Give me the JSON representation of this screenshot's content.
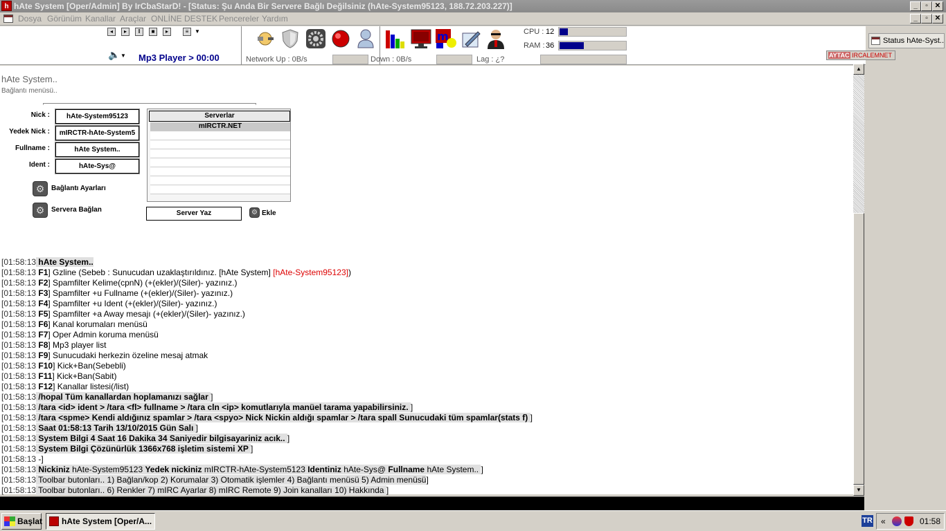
{
  "window": {
    "title": "hAte System [Oper/Admin] By IrCbaStarD! - [Status: Şu Anda Bir Servere Bağlı Değilsiniz (hAte-System95123, 188.72.203.227)]",
    "min": "_",
    "max": "▫",
    "close": "✕"
  },
  "menubar": {
    "items": [
      "Dosya",
      "Görünüm",
      "Kanallar",
      "Araçlar",
      "ONLİNE DESTEK",
      "Pencereler",
      "Yardım"
    ]
  },
  "toolbar": {
    "mp3": "Mp3 Player > 00:00",
    "cpu_label": "CPU :",
    "cpu_value": "12",
    "cpu_fill": 12,
    "ram_label": "RAM :",
    "ram_value": "36",
    "ram_fill": 36,
    "net_up": "Network Up :  0B/s",
    "down": "Down :  0B/s",
    "lag": "Lag :    ¿?",
    "icons": [
      "plug-icon",
      "shield-icon",
      "gear-icon",
      "red-ball-icon",
      "user-icon",
      "bar-chart-icon",
      "monitor-icon",
      "mirc-icon",
      "notepad-icon",
      "agent-icon"
    ]
  },
  "sidepanel": {
    "status_button": "Status hAte-Syst...",
    "banner_a": "AYTAC",
    "banner_b": "IRCALEMNET"
  },
  "connect": {
    "title": "hAte System..",
    "subtitle": "Bağlantı menüsü..",
    "nick_label": "Nick :",
    "nick": "hAte-System95123",
    "alt_label": "Yedek Nick :",
    "alt": "mIRCTR-hAte-System5",
    "full_label": "Fullname :",
    "full": "hAte System..",
    "ident_label": "Ident :",
    "ident": "hAte-Sys@",
    "settings": "Bağlantı Ayarları",
    "connect": "Servera Bağlan",
    "servers_header": "Serverlar",
    "servers": [
      "mIRCTR.NET"
    ],
    "server_write": "Server Yaz",
    "add": "Ekle"
  },
  "log": [
    {
      "ts": "[01:58:13",
      "parts": [
        {
          "t": " hAte System..",
          "c": "b hl"
        }
      ]
    },
    {
      "ts": "[01:58:13",
      "parts": [
        {
          "t": " F1",
          "c": "b"
        },
        {
          "t": "] Gzline (Sebeb : Sunucudan uzaklaştırıldınız. [hAte System] "
        },
        {
          "t": "[hAte-System95123]",
          "c": "red"
        },
        {
          "t": ")"
        }
      ]
    },
    {
      "ts": "[01:58:13",
      "parts": [
        {
          "t": " F2",
          "c": "b"
        },
        {
          "t": "] Spamfilter Kelime(cpnN) (+(ekler)/(Siler)- yazınız.)"
        }
      ]
    },
    {
      "ts": "[01:58:13",
      "parts": [
        {
          "t": " F3",
          "c": "b"
        },
        {
          "t": "] Spamfilter +u Fullname (+(ekler)/(Siler)- yazınız.)"
        }
      ]
    },
    {
      "ts": "[01:58:13",
      "parts": [
        {
          "t": " F4",
          "c": "b"
        },
        {
          "t": "] Spamfilter +u Ident (+(ekler)/(Siler)- yazınız.)"
        }
      ]
    },
    {
      "ts": "[01:58:13",
      "parts": [
        {
          "t": " F5",
          "c": "b"
        },
        {
          "t": "] Spamfilter +a Away mesajı (+(ekler)/(Siler)- yazınız.)"
        }
      ]
    },
    {
      "ts": "[01:58:13",
      "parts": [
        {
          "t": " F6",
          "c": "b"
        },
        {
          "t": "] Kanal korumaları menüsü"
        }
      ]
    },
    {
      "ts": "[01:58:13",
      "parts": [
        {
          "t": " F7",
          "c": "b"
        },
        {
          "t": "] Oper Admin koruma menüsü"
        }
      ]
    },
    {
      "ts": "[01:58:13",
      "parts": [
        {
          "t": " F8",
          "c": "b"
        },
        {
          "t": "] Mp3 player list"
        }
      ]
    },
    {
      "ts": "[01:58:13",
      "parts": [
        {
          "t": " F9",
          "c": "b"
        },
        {
          "t": "] Sunucudaki herkezin özeline mesaj atmak"
        }
      ]
    },
    {
      "ts": "[01:58:13",
      "parts": [
        {
          "t": " F10",
          "c": "b"
        },
        {
          "t": "] Kick+Ban(Sebebli)"
        }
      ]
    },
    {
      "ts": "[01:58:13",
      "parts": [
        {
          "t": " F11",
          "c": "b"
        },
        {
          "t": "] Kick+Ban(Sabit)"
        }
      ]
    },
    {
      "ts": "[01:58:13",
      "parts": [
        {
          "t": " F12",
          "c": "b"
        },
        {
          "t": "] Kanallar listesi(/list)"
        }
      ]
    },
    {
      "ts": "[01:58:13",
      "parts": [
        {
          "t": " /hopal Tüm kanallardan hoplamanızı sağlar ",
          "c": "b hl"
        },
        {
          "t": "]"
        }
      ]
    },
    {
      "ts": "[01:58:13",
      "parts": [
        {
          "t": " /tara <id> ident > /tara <fl> fullname > /tara cln <ip> komutlarıyla manüel tarama yapabilirsiniz. ",
          "c": "b hl"
        },
        {
          "t": "]"
        }
      ]
    },
    {
      "ts": "[01:58:13",
      "parts": [
        {
          "t": " /tara <spme> Kendi aldığınız spamlar > /tara <spyo> Nick Nickin aldığı spamlar > /tara spall Sunucudaki tüm spamlar(stats f) ",
          "c": "b hl"
        },
        {
          "t": "]"
        }
      ]
    },
    {
      "ts": "[01:58:13",
      "parts": [
        {
          "t": " Saat 01:58:13 Tarih 13/10/2015 Gün Salı ",
          "c": "b hl"
        },
        {
          "t": "]"
        }
      ]
    },
    {
      "ts": "[01:58:13",
      "parts": [
        {
          "t": " System Bilgi 4 Saat 16 Dakika 34 Saniyedir bilgisayariniz acık.. ",
          "c": "b hl"
        },
        {
          "t": "]"
        }
      ]
    },
    {
      "ts": "[01:58:13",
      "parts": [
        {
          "t": " System Bilgi Çözünürlük 1366x768 işletim sistemi XP ",
          "c": "b hl"
        },
        {
          "t": "]"
        }
      ]
    },
    {
      "ts": "[01:58:13",
      "parts": [
        {
          "t": " -]"
        }
      ]
    },
    {
      "ts": "[01:58:13",
      "parts": [
        {
          "t": " Nickiniz ",
          "c": "b hl"
        },
        {
          "t": "hAte-System95123 ",
          "c": "hl"
        },
        {
          "t": "Yedek nickiniz ",
          "c": "b hl"
        },
        {
          "t": "mIRCTR-hAte-System5123 ",
          "c": "hl"
        },
        {
          "t": "Identiniz ",
          "c": "b hl"
        },
        {
          "t": "hAte-Sys@ ",
          "c": "hl"
        },
        {
          "t": "Fullname ",
          "c": "b hl"
        },
        {
          "t": "hAte System.. ",
          "c": "hl"
        },
        {
          "t": "]"
        }
      ]
    },
    {
      "ts": "[01:58:13",
      "parts": [
        {
          "t": " Toolbar butonları.. 1) Bağlan/kop 2) Korumalar 3) Otomatik işlemler 4) Bağlantı menüsü 5) Admin menüsü",
          "c": "hl"
        },
        {
          "t": "]"
        }
      ]
    },
    {
      "ts": "[01:58:13",
      "parts": [
        {
          "t": " Toolbar butonları.. 6) Renkler 7) mIRC Ayarlar 8) mIRC Remote 9) Join kanalları 10) Hakkında ",
          "c": "hl"
        },
        {
          "t": "]"
        }
      ]
    }
  ],
  "taskbar": {
    "start": "Başlat",
    "task": "hAte System [Oper/A...",
    "lang": "TR",
    "chev": "«",
    "clock": "01:58"
  }
}
